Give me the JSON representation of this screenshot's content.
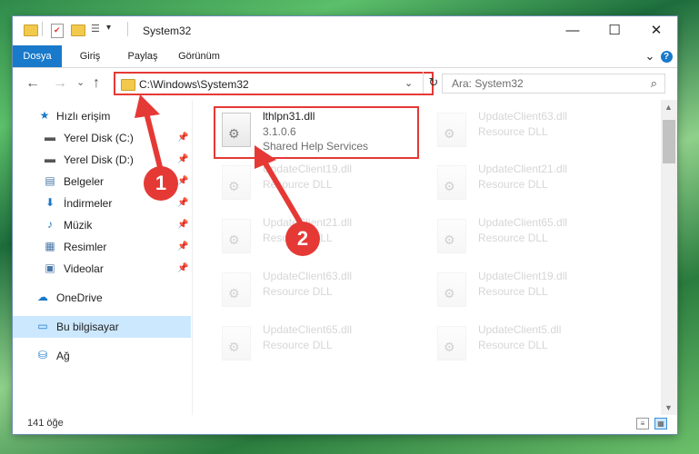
{
  "window": {
    "title": "System32",
    "controls": {
      "minimize": "—",
      "maximize": "☐",
      "close": "✕"
    }
  },
  "ribbon": {
    "tabs": [
      "Dosya",
      "Giriş",
      "Paylaş",
      "Görünüm"
    ],
    "collapse_icon": "⌄",
    "help_icon": "?"
  },
  "address": {
    "path": "C:\\Windows\\System32",
    "dropdown_icon": "⌄",
    "refresh_icon": "↻"
  },
  "nav_buttons": {
    "back": "←",
    "forward": "→",
    "recent": "⌄",
    "up": "↑"
  },
  "search": {
    "placeholder": "Ara: System32",
    "icon": "⌕"
  },
  "sidebar": {
    "items": [
      {
        "label": "Hızlı erişim",
        "icon": "★",
        "pinned": false
      },
      {
        "label": "Yerel Disk (C:)",
        "icon": "▬",
        "pinned": true
      },
      {
        "label": "Yerel Disk (D:)",
        "icon": "▬",
        "pinned": true
      },
      {
        "label": "Belgeler",
        "icon": "▤",
        "pinned": true
      },
      {
        "label": "İndirmeler",
        "icon": "⬇",
        "pinned": true
      },
      {
        "label": "Müzik",
        "icon": "♪",
        "pinned": true
      },
      {
        "label": "Resimler",
        "icon": "▦",
        "pinned": true
      },
      {
        "label": "Videolar",
        "icon": "▣",
        "pinned": true
      },
      {
        "label": "OneDrive",
        "icon": "☁",
        "pinned": false
      },
      {
        "label": "Bu bilgisayar",
        "icon": "▭",
        "pinned": false
      },
      {
        "label": "Ağ",
        "icon": "⛁",
        "pinned": false
      }
    ],
    "pin_icon": "📌"
  },
  "files": {
    "highlighted": {
      "name": "lthlpn31.dll",
      "version": "3.1.0.6",
      "description": "Shared Help Services"
    },
    "left_column": [
      {
        "name": "",
        "type": ""
      },
      {
        "name": "UpdateClient19.dll",
        "type": "Resource DLL"
      },
      {
        "name": "UpdateClient21.dll",
        "type": "Resource DLL"
      },
      {
        "name": "UpdateClient63.dll",
        "type": "Resource DLL"
      },
      {
        "name": "UpdateClient65.dll",
        "type": "Resource DLL"
      }
    ],
    "right_column": [
      {
        "name": "UpdateClient63.dll",
        "type": "Resource DLL"
      },
      {
        "name": "UpdateClient21.dll",
        "type": "Resource DLL"
      },
      {
        "name": "UpdateClient65.dll",
        "type": "Resource DLL"
      },
      {
        "name": "UpdateClient19.dll",
        "type": "Resource DLL"
      },
      {
        "name": "UpdateClient5.dll",
        "type": "Resource DLL"
      }
    ]
  },
  "status": {
    "item_count": "141 öğe"
  },
  "annotations": {
    "step1": "1",
    "step2": "2",
    "color": "#e53935"
  }
}
